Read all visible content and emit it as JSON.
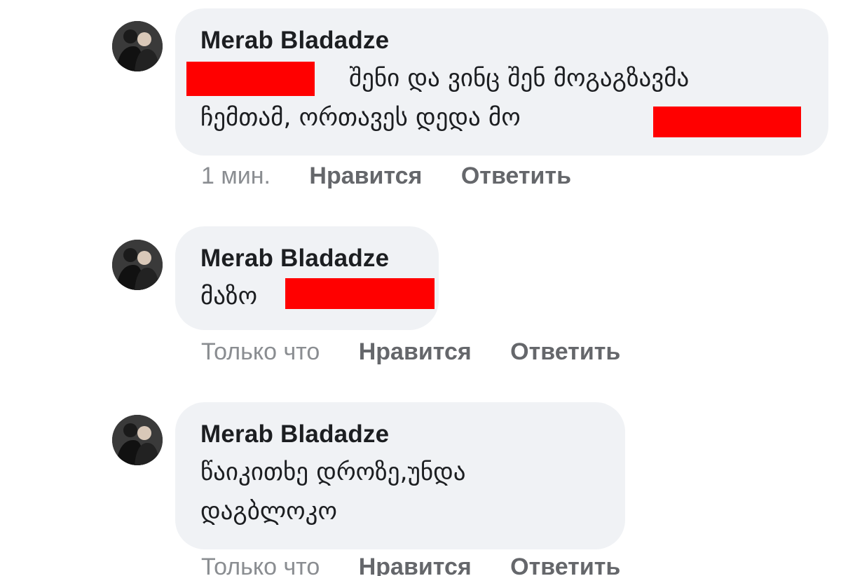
{
  "comments": [
    {
      "author": "Merab Bladadze",
      "lines": [
        "შენი და ვინც შენ მოგაგზავმა",
        "ჩემთამ, ორთავეს დედა მო"
      ],
      "time": "1 мин.",
      "like": "Нравится",
      "reply": "Ответить"
    },
    {
      "author": "Merab Bladadze",
      "lines": [
        "მაზო"
      ],
      "time": "Только что",
      "like": "Нравится",
      "reply": "Ответить"
    },
    {
      "author": "Merab Bladadze",
      "lines": [
        "წაიკითხე დროზე,უნდა",
        "დაგბლოკო"
      ],
      "time": "Только что",
      "like": "Нравится",
      "reply": "Ответить"
    }
  ],
  "colors": {
    "bubble": "#f0f2f5",
    "redaction": "#ff0000",
    "meta_text": "#65676b"
  }
}
